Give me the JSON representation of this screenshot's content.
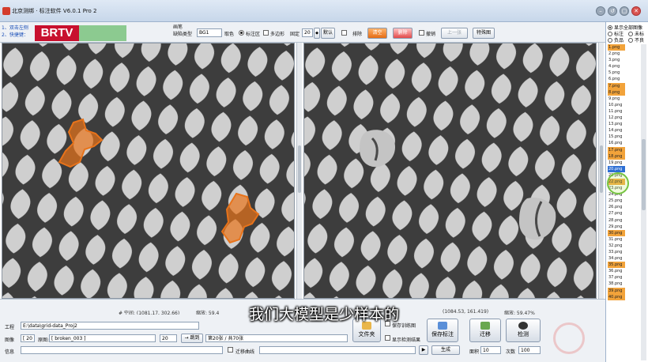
{
  "window": {
    "title": "北京测绑 · 标注软件 V6.0.1 Pro 2",
    "controls": [
      "–",
      "↺",
      "▢",
      "✕"
    ]
  },
  "toolbar": {
    "hints": [
      "1、双击左侧",
      "2、快捷键："
    ],
    "overlay_logo": "BRTV",
    "group_label": "画笔",
    "defect_type_label": "缺陷类型",
    "defect_type_value": "BG1",
    "color_label": "取色",
    "label_area_option": "标注区",
    "polygon_option": "多边形",
    "fixed_label": "固定",
    "fixed_value": "20",
    "default_button": "默认",
    "exclude_label": "排除",
    "clear_button": "清空",
    "delete_button": "删除",
    "restore_label": "撤销",
    "prev_button": "上一张",
    "special_button": "特殊图"
  },
  "status": {
    "left_coords": "# 空间: (1081.17, 302.66)",
    "left_zoom": "缩放: 59.4",
    "right_coords": "(1084.53, 161.419)",
    "right_zoom": "缩放: 59.47%"
  },
  "subtitle": "我们大模型是少样本的",
  "bottom": {
    "project_label": "工程",
    "project_path": "E:\\data\\grid-data_Proj2",
    "image_label": "图像",
    "image_index": "[ 20 ]",
    "origin_label": "原图:",
    "origin_value": "[ broken_003 ]",
    "jump_value": "20",
    "jump_button": "→ 跳到",
    "page_text": "第20张 / 共70张",
    "info_label": "信息",
    "migrate_curve_label": "迁移曲线",
    "next_small": "▶",
    "generate_button": "生成",
    "area_label": "面积",
    "area_value": "10",
    "count_label": "次数",
    "count_value": "100",
    "checks": [
      "保存训练图",
      "显示检测结果"
    ],
    "folder_button": "文件夹",
    "save_label_button": "保存标注",
    "migrate_button": "迁移",
    "detect_button": "检测"
  },
  "right_panel": {
    "options": [
      "显示全部图像",
      "标注",
      "未标",
      "负品",
      "不良"
    ],
    "files": [
      {
        "name": "1.png",
        "state": "orange"
      },
      {
        "name": "2.png",
        "state": "none"
      },
      {
        "name": "3.png",
        "state": "none"
      },
      {
        "name": "4.png",
        "state": "none"
      },
      {
        "name": "5.png",
        "state": "none"
      },
      {
        "name": "6.png",
        "state": "none"
      },
      {
        "name": "7.png",
        "state": "orange"
      },
      {
        "name": "8.png",
        "state": "orange"
      },
      {
        "name": "9.png",
        "state": "none"
      },
      {
        "name": "10.png",
        "state": "none"
      },
      {
        "name": "11.png",
        "state": "none"
      },
      {
        "name": "12.png",
        "state": "none"
      },
      {
        "name": "13.png",
        "state": "none"
      },
      {
        "name": "14.png",
        "state": "none"
      },
      {
        "name": "15.png",
        "state": "none"
      },
      {
        "name": "16.png",
        "state": "none"
      },
      {
        "name": "17.png",
        "state": "orange"
      },
      {
        "name": "18.png",
        "state": "orange"
      },
      {
        "name": "19.png",
        "state": "none"
      },
      {
        "name": "20.png",
        "state": "blue"
      },
      {
        "name": "21.png",
        "state": "none"
      },
      {
        "name": "22.png",
        "state": "orange"
      },
      {
        "name": "23.png",
        "state": "none"
      },
      {
        "name": "24.png",
        "state": "none"
      },
      {
        "name": "25.png",
        "state": "none"
      },
      {
        "name": "26.png",
        "state": "none"
      },
      {
        "name": "27.png",
        "state": "none"
      },
      {
        "name": "28.png",
        "state": "none"
      },
      {
        "name": "29.png",
        "state": "none"
      },
      {
        "name": "30.png",
        "state": "orange"
      },
      {
        "name": "31.png",
        "state": "none"
      },
      {
        "name": "32.png",
        "state": "none"
      },
      {
        "name": "33.png",
        "state": "none"
      },
      {
        "name": "34.png",
        "state": "none"
      },
      {
        "name": "35.png",
        "state": "orange"
      },
      {
        "name": "36.png",
        "state": "none"
      },
      {
        "name": "37.png",
        "state": "none"
      },
      {
        "name": "38.png",
        "state": "none"
      },
      {
        "name": "39.png",
        "state": "orange"
      },
      {
        "name": "40.png",
        "state": "orange"
      }
    ]
  },
  "colors": {
    "accent_orange": "#f2a33a",
    "selection_blue": "#2e6fd4",
    "defect_overlay": "#e8731a",
    "mesh_dark": "#3a3a3a",
    "mesh_light": "#c9c9c9"
  }
}
